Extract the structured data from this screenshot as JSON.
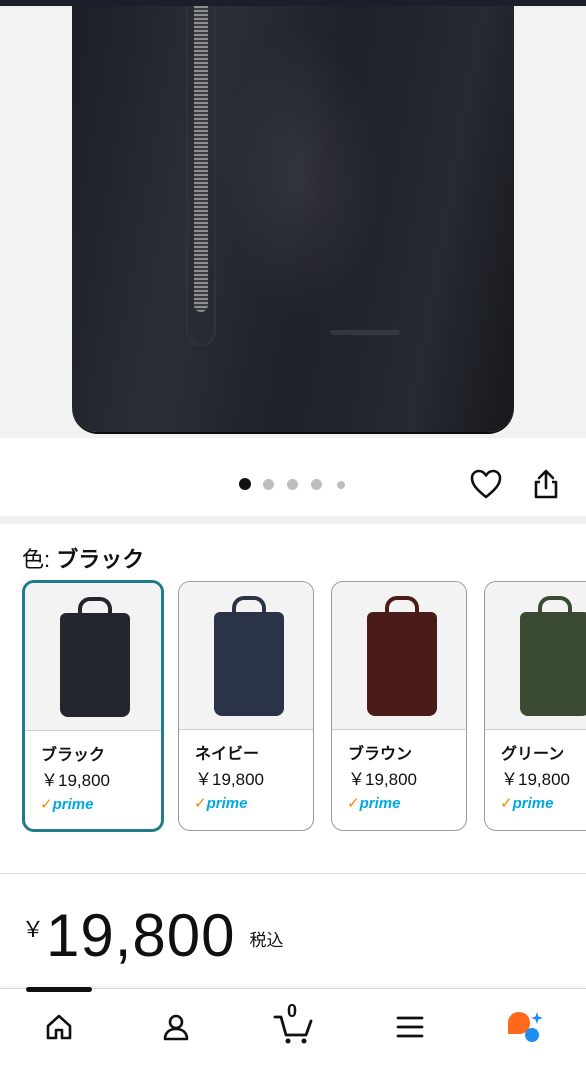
{
  "gallery": {
    "dot_count": 5,
    "active_index": 0
  },
  "colors": {
    "accent": "#227b8a",
    "prime_orange": "#f08804",
    "prime_blue": "#00a8e1",
    "assistant_orange": "#ff6a1a",
    "assistant_blue": "#1d8ef0"
  },
  "variant_section": {
    "label_prefix": "色: ",
    "selected_label": "ブラック"
  },
  "variants": [
    {
      "name": "ブラック",
      "price": "￥19,800",
      "badge": "prime",
      "color": "#23262c"
    },
    {
      "name": "ネイビー",
      "price": "￥19,800",
      "badge": "prime",
      "color": "#2b3447"
    },
    {
      "name": "ブラウン",
      "price": "￥19,800",
      "badge": "prime",
      "color": "#4a1c17"
    },
    {
      "name": "グリーン",
      "price": "￥19,800",
      "badge": "prime",
      "color": "#3a4a33"
    }
  ],
  "price": {
    "currency_symbol": "￥",
    "amount": "19,800",
    "tax_note": "税込"
  },
  "bottom_nav": {
    "cart_count": "0",
    "items": [
      "home-icon",
      "account-icon",
      "cart-icon",
      "menu-icon",
      "assistant-icon"
    ]
  }
}
